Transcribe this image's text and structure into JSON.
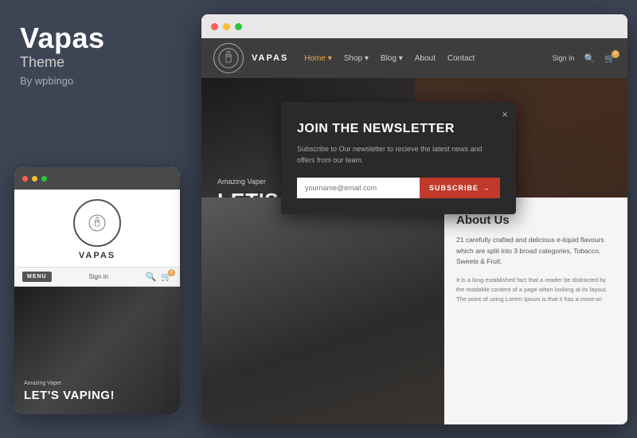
{
  "left_panel": {
    "brand_name": "Vapas",
    "brand_theme": "Theme",
    "brand_by": "By wpbingo"
  },
  "mobile_preview": {
    "dots": [
      "red",
      "yellow",
      "green"
    ],
    "logo_text": "VAPAS",
    "menu_label": "MENU",
    "sign_in": "Sign in",
    "amazing_text": "Amazing Vaper",
    "hero_heading": "LET'S VAPING!"
  },
  "browser": {
    "dots": [
      "red",
      "yellow",
      "green"
    ],
    "site": {
      "header": {
        "logo_name": "VAPAS",
        "nav_items": [
          {
            "label": "Home",
            "active": true
          },
          {
            "label": "Shop"
          },
          {
            "label": "Blog"
          },
          {
            "label": "About"
          },
          {
            "label": "Contact"
          }
        ],
        "sign_in": "Sign In"
      },
      "hero": {
        "amazing_text": "Amazing Vaper",
        "heading": "LET'S VAPING!"
      },
      "newsletter": {
        "title": "JOIN THE NEWSLETTER",
        "description": "Subscribe to Our newsletter to recieve the latest news and offers from our team.",
        "email_placeholder": "yourname@email.com",
        "subscribe_btn": "SUBSCRIBE",
        "close_btn": "×"
      },
      "about": {
        "title": "About Us",
        "paragraph1": "21 carefully crafted and delicious e-liquid flavours which are split into 3 broad categories, Tobacco, Sweets & Fruit.",
        "paragraph2": "It is a long established fact that a reader be distracted by the readable content of a page when looking at its layout. The point of using Lorem Ipsum is that it has a more-or-"
      }
    }
  }
}
